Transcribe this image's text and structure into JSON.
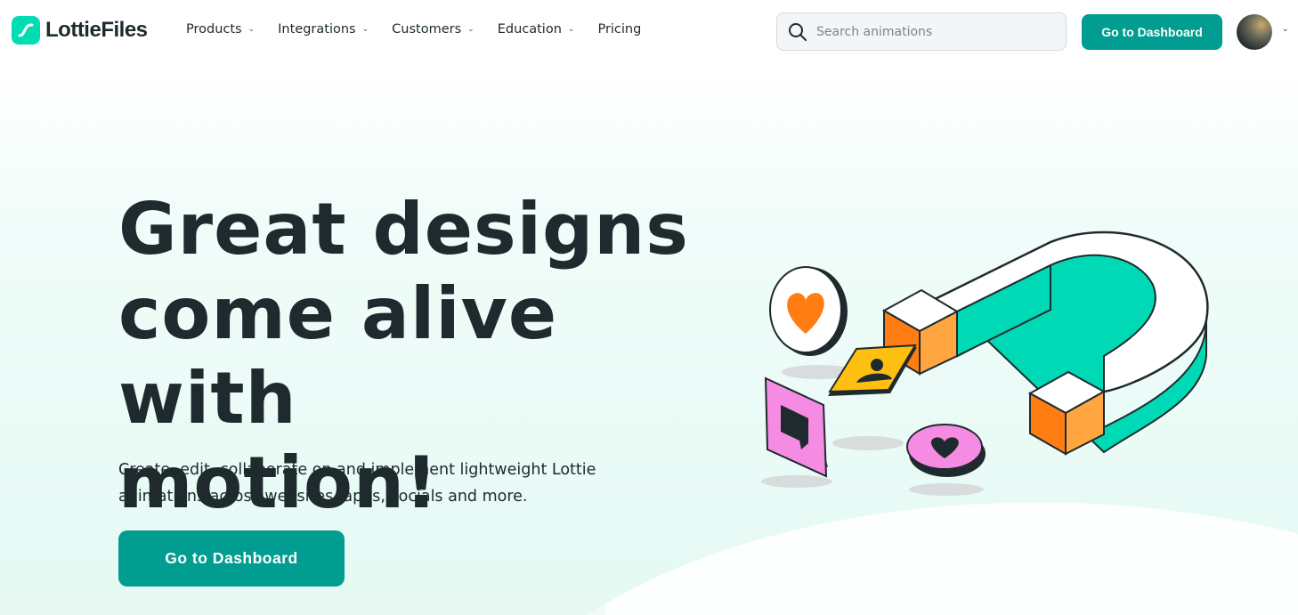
{
  "header": {
    "logo_text": "LottieFiles",
    "nav": [
      {
        "label": "Products",
        "has_dropdown": true
      },
      {
        "label": "Integrations",
        "has_dropdown": true
      },
      {
        "label": "Customers",
        "has_dropdown": true
      },
      {
        "label": "Education",
        "has_dropdown": true
      },
      {
        "label": "Pricing",
        "has_dropdown": false
      }
    ],
    "search_placeholder": "Search animations",
    "dashboard_button": "Go to Dashboard"
  },
  "hero": {
    "headline_line1": "Great designs",
    "headline_line2": "come alive with",
    "headline_line3": "motion!",
    "subtitle": "Create, edit, collaborate on and implement lightweight Lottie animations across websites, apps, socials and more.",
    "cta_button": "Go to Dashboard"
  },
  "colors": {
    "brand_teal": "#019d91",
    "logo_green": "#00ddb3",
    "magnet_teal": "#00d9b5",
    "orange": "#ff7d12",
    "pink": "#f58be2",
    "yellow": "#ffbf10"
  },
  "icons": [
    "logo-icon",
    "chevron-down-icon",
    "search-icon",
    "avatar",
    "magnet-illustration"
  ]
}
